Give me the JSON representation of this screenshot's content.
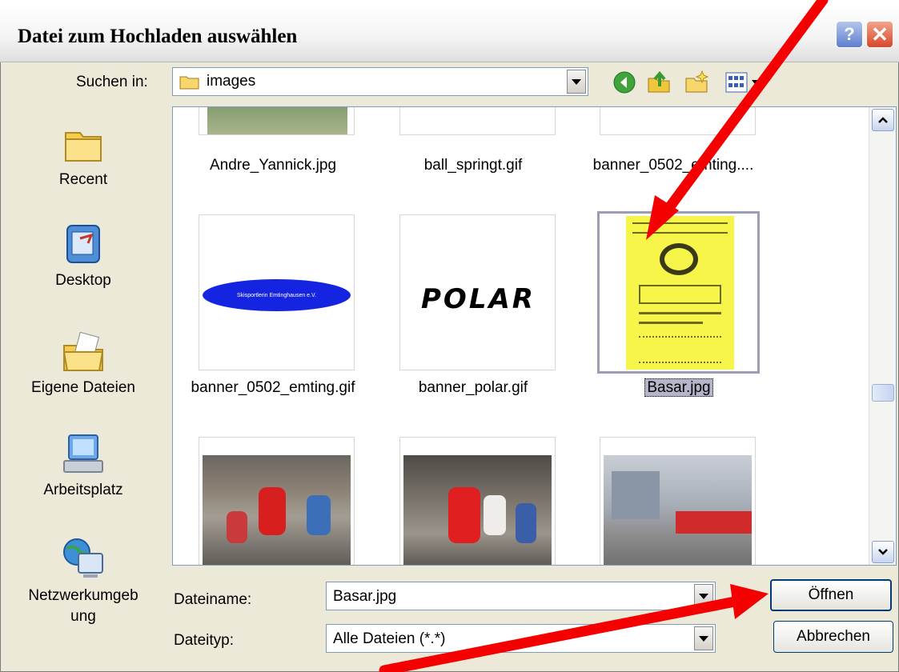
{
  "window": {
    "title": "Datei zum Hochladen auswählen",
    "help_glyph": "?",
    "close_glyph": "✕"
  },
  "lookin": {
    "label": "Suchen in:",
    "value": "images"
  },
  "toolbar": {
    "icons": [
      "back-icon",
      "up-folder-icon",
      "new-folder-icon",
      "view-menu-icon"
    ]
  },
  "places": [
    {
      "label": "Recent",
      "icon": "recent-folder-icon"
    },
    {
      "label": "Desktop",
      "icon": "desktop-icon"
    },
    {
      "label": "Eigene Dateien",
      "icon": "my-documents-icon"
    },
    {
      "label": "Arbeitsplatz",
      "icon": "my-computer-icon"
    },
    {
      "label": "Netzwerkumgeb ung",
      "icon": "network-icon"
    }
  ],
  "files": [
    {
      "name": "Andre_Yannick.jpg"
    },
    {
      "name": "ball_springt.gif"
    },
    {
      "name": "banner_0502_emting...."
    },
    {
      "name": "banner_0502_emting.gif",
      "banner_text": "Skisportlerin Emtinghausen e.V."
    },
    {
      "name": "banner_polar.gif",
      "logo_text": "POLAR"
    },
    {
      "name": "Basar.jpg",
      "selected": true
    },
    {
      "name": ""
    },
    {
      "name": ""
    },
    {
      "name": ""
    }
  ],
  "filename": {
    "label": "Dateiname:",
    "value": "Basar.jpg"
  },
  "filetype": {
    "label": "Dateityp:",
    "value": "Alle Dateien (*.*)"
  },
  "buttons": {
    "open": "Öffnen",
    "cancel": "Abbrechen"
  },
  "colors": {
    "accent_arrow": "#f40000",
    "selection": "#b5b5c9",
    "dialog_bg": "#ece9d8"
  }
}
